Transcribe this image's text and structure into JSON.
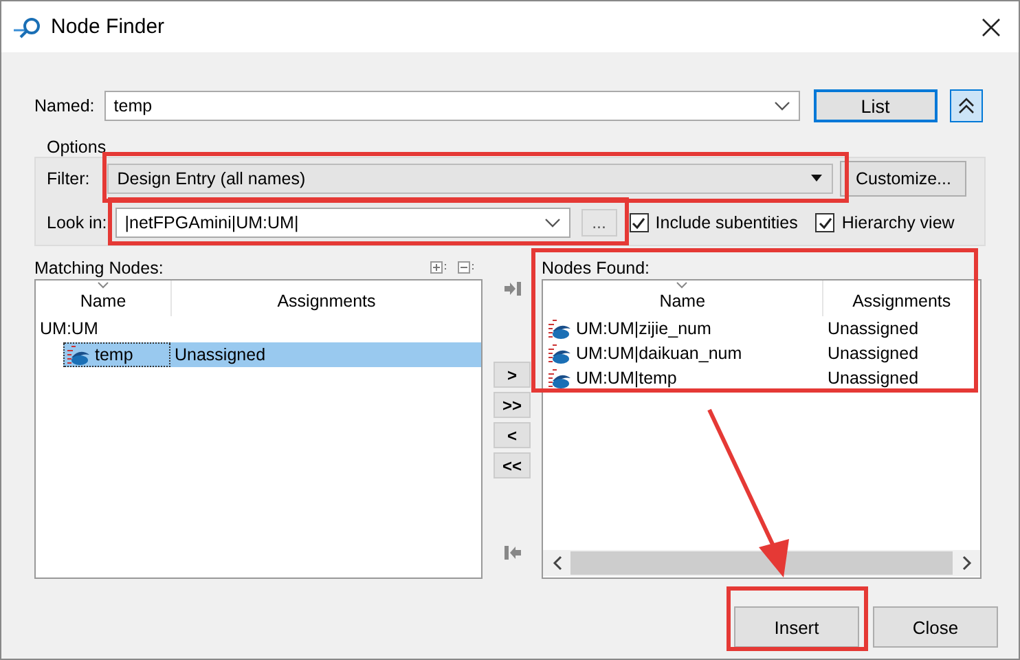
{
  "window": {
    "title": "Node Finder"
  },
  "named": {
    "label": "Named:",
    "value": "temp"
  },
  "list_button": "List",
  "options": {
    "title": "Options",
    "filter": {
      "label": "Filter:",
      "value": "Design Entry (all names)"
    },
    "customize_button": "Customize...",
    "look_in": {
      "label": "Look in:",
      "value": "|netFPGAmini|UM:UM|"
    },
    "browse_button": "...",
    "checkboxes": [
      {
        "label": "Include subentities",
        "checked": true
      },
      {
        "label": "Hierarchy view",
        "checked": true
      }
    ]
  },
  "matching_nodes": {
    "title": "Matching Nodes:",
    "columns": [
      "Name",
      "Assignments"
    ],
    "tree": [
      {
        "name": "UM:UM",
        "children": [
          {
            "name": "temp",
            "assignment": "Unassigned",
            "selected": true
          }
        ]
      }
    ]
  },
  "transfer_buttons": [
    ">",
    ">>",
    "<",
    "<<"
  ],
  "nodes_found": {
    "title": "Nodes Found:",
    "columns": [
      "Name",
      "Assignments"
    ],
    "rows": [
      {
        "name": "UM:UM|zijie_num",
        "assignment": "Unassigned",
        "selected": false
      },
      {
        "name": "UM:UM|daikuan_num",
        "assignment": "Unassigned",
        "selected": false
      },
      {
        "name": "UM:UM|temp",
        "assignment": "Unassigned",
        "selected": false
      }
    ]
  },
  "buttons": [
    "Insert",
    "Close"
  ]
}
